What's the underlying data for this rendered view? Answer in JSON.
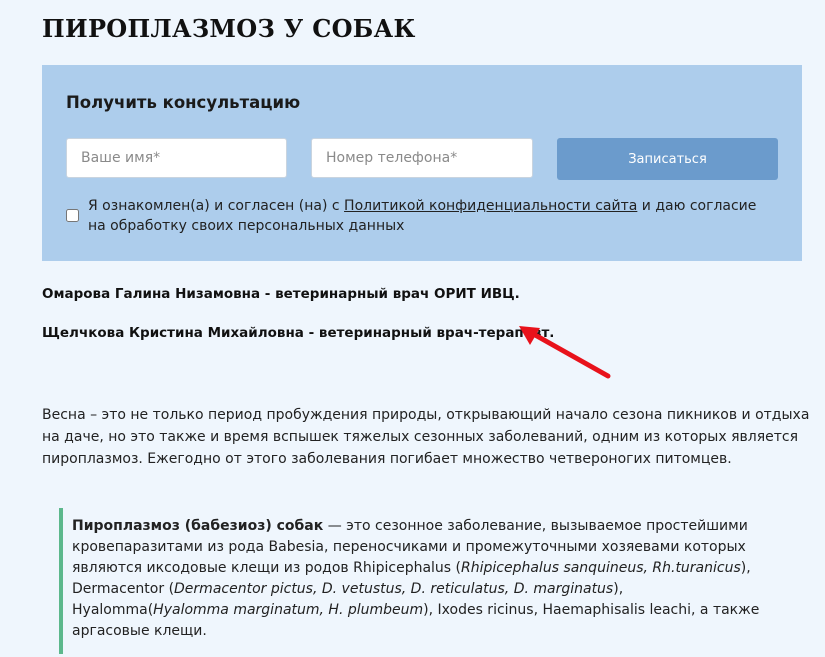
{
  "page": {
    "title": "ПИРОПЛАЗМОЗ У СОБАК"
  },
  "consultation": {
    "title": "Получить консультацию",
    "name_placeholder": "Ваше имя*",
    "phone_placeholder": "Номер телефона*",
    "submit_label": "Записаться",
    "consent_before": "Я ознакомлен(а) и согласен (на) с ",
    "consent_link": "Политикой конфиденциальности сайта",
    "consent_after": " и даю согласие на обработку своих персональных данных",
    "consent_checked": false
  },
  "doctors": [
    "Омарова Галина Низамовна - ветеринарный врач ОРИТ ИВЦ.",
    "Щелчкова Кристина Михайловна - ветеринарный врач-терапевт."
  ],
  "colors": {
    "background": "#eff6fd",
    "form_background": "#adcdec",
    "button": "#6b9bcc",
    "annotation_arrow": "#e8121b",
    "quote_border": "#5cb88c"
  },
  "intro": "Весна – это не только период пробуждения природы, открывающий начало сезона пикников и отдыха на даче, но это также и время вспышек тяжелых сезонных заболеваний, одним из которых является пироплазмоз. Ежегодно от этого заболевания погибает множество четвероногих питомцев.",
  "definition": {
    "term": "Пироплазмоз (бабезиоз) собак",
    "text_1": " — это сезонное заболевание, вызываемое простейшими кровепаразитами из рода Babesia, переносчиками и промежуточными хозяевами  которых являются иксодовые клещи из родов Rhipicephalus (",
    "latin_1": "Rhipicephalus sanquineus, Rh.turanicus",
    "text_2": "), Dermacentor (",
    "latin_2": "Dermacentor pictus, D. vetustus, D. reticulatus, D. marginatus",
    "text_3": "), Hyalomma(",
    "latin_3": "Hyalomma marginatum, H. plumbeum",
    "text_4": "), Ixodes ricinus, Haemaphisalis leachi, а также аргасовые клещи."
  }
}
